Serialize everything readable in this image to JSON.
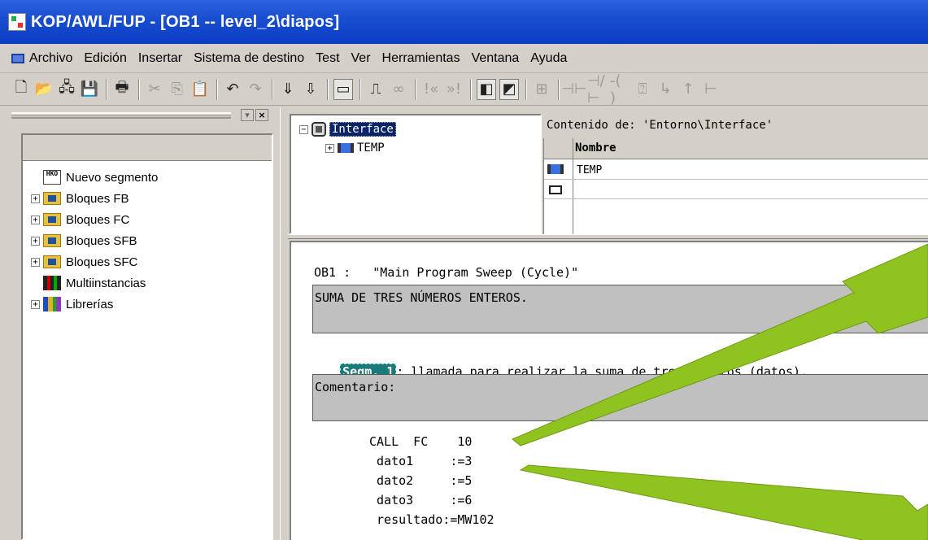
{
  "window": {
    "title": "KOP/AWL/FUP  - [OB1 -- level_2\\diapos]"
  },
  "menu": {
    "items": [
      "Archivo",
      "Edición",
      "Insertar",
      "Sistema de destino",
      "Test",
      "Ver",
      "Herramientas",
      "Ventana",
      "Ayuda"
    ]
  },
  "toolbar": {
    "buttons": [
      {
        "icon": "new-icon",
        "glyph": "🗋"
      },
      {
        "icon": "open-icon",
        "glyph": "📂"
      },
      {
        "icon": "accessible-nodes-icon",
        "glyph": "🖧"
      },
      {
        "icon": "save-icon",
        "glyph": "💾"
      },
      {
        "icon": "print-icon",
        "glyph": "🖶"
      },
      {
        "icon": "cut-icon",
        "glyph": "✂"
      },
      {
        "icon": "copy-icon",
        "glyph": "⎘"
      },
      {
        "icon": "paste-icon",
        "glyph": "📋"
      },
      {
        "icon": "undo-icon",
        "glyph": "↶"
      },
      {
        "icon": "redo-icon",
        "glyph": "↷"
      },
      {
        "icon": "load-icon",
        "glyph": "⇓"
      },
      {
        "icon": "download-icon",
        "glyph": "⇩"
      },
      {
        "icon": "overview-icon",
        "glyph": "▭"
      },
      {
        "icon": "online-icon",
        "glyph": "⎍"
      },
      {
        "icon": "monitor-icon",
        "glyph": "∞"
      },
      {
        "icon": "prev-segment-icon",
        "glyph": "!«"
      },
      {
        "icon": "next-segment-icon",
        "glyph": "»!"
      },
      {
        "icon": "view-overview-icon",
        "glyph": "◧"
      },
      {
        "icon": "view-details-icon",
        "glyph": "◩"
      },
      {
        "icon": "new-segment-icon",
        "glyph": "⊞"
      },
      {
        "icon": "no-contact-icon",
        "glyph": "⊣⊢"
      },
      {
        "icon": "nc-contact-icon",
        "glyph": "⊣/⊢"
      },
      {
        "icon": "coil-icon",
        "glyph": "-( )"
      },
      {
        "icon": "empty-box-icon",
        "glyph": "⍰"
      },
      {
        "icon": "branch-open-icon",
        "glyph": "↳"
      },
      {
        "icon": "branch-close-icon",
        "glyph": "↑"
      },
      {
        "icon": "connection-icon",
        "glyph": "⊢"
      }
    ]
  },
  "left_tree": {
    "items": [
      {
        "label": "Nuevo segmento",
        "icon": "new-segment-icon",
        "expandable": false
      },
      {
        "label": "Bloques FB",
        "icon": "folder-icon",
        "expandable": true
      },
      {
        "label": "Bloques FC",
        "icon": "folder-icon",
        "expandable": true
      },
      {
        "label": "Bloques SFB",
        "icon": "folder-icon",
        "expandable": true
      },
      {
        "label": "Bloques SFC",
        "icon": "folder-icon",
        "expandable": true
      },
      {
        "label": "Multiinstancias",
        "icon": "multiinstance-icon",
        "expandable": false
      },
      {
        "label": "Librerías",
        "icon": "library-icon",
        "expandable": true
      }
    ],
    "seg_icon_text": "HKO"
  },
  "interface_tree": {
    "root": "Interface",
    "child": "TEMP"
  },
  "contenido": {
    "title": "Contenido de: 'Entorno\\Interface'",
    "column": "Nombre",
    "rows": [
      "TEMP"
    ]
  },
  "editor": {
    "block_line": "OB1 :   \"Main Program Sweep (Cycle)\"",
    "block_comment": "SUMA DE TRES NÚMEROS ENTEROS.",
    "segment_label": "Segm. 1",
    "segment_title": ": llamada para realizar la suma de tres numeros (datos).",
    "segment_comment": "Comentario:",
    "code": [
      "CALL  FC    10",
      " dato1     :=3",
      " dato2     :=5",
      " dato3     :=6",
      " resultado:=MW102"
    ]
  },
  "colors": {
    "titlebar": "#0a3dc2",
    "arrow": "#8fc31f",
    "selection": "#0a246a",
    "segment_badge": "#1a7a7a"
  }
}
